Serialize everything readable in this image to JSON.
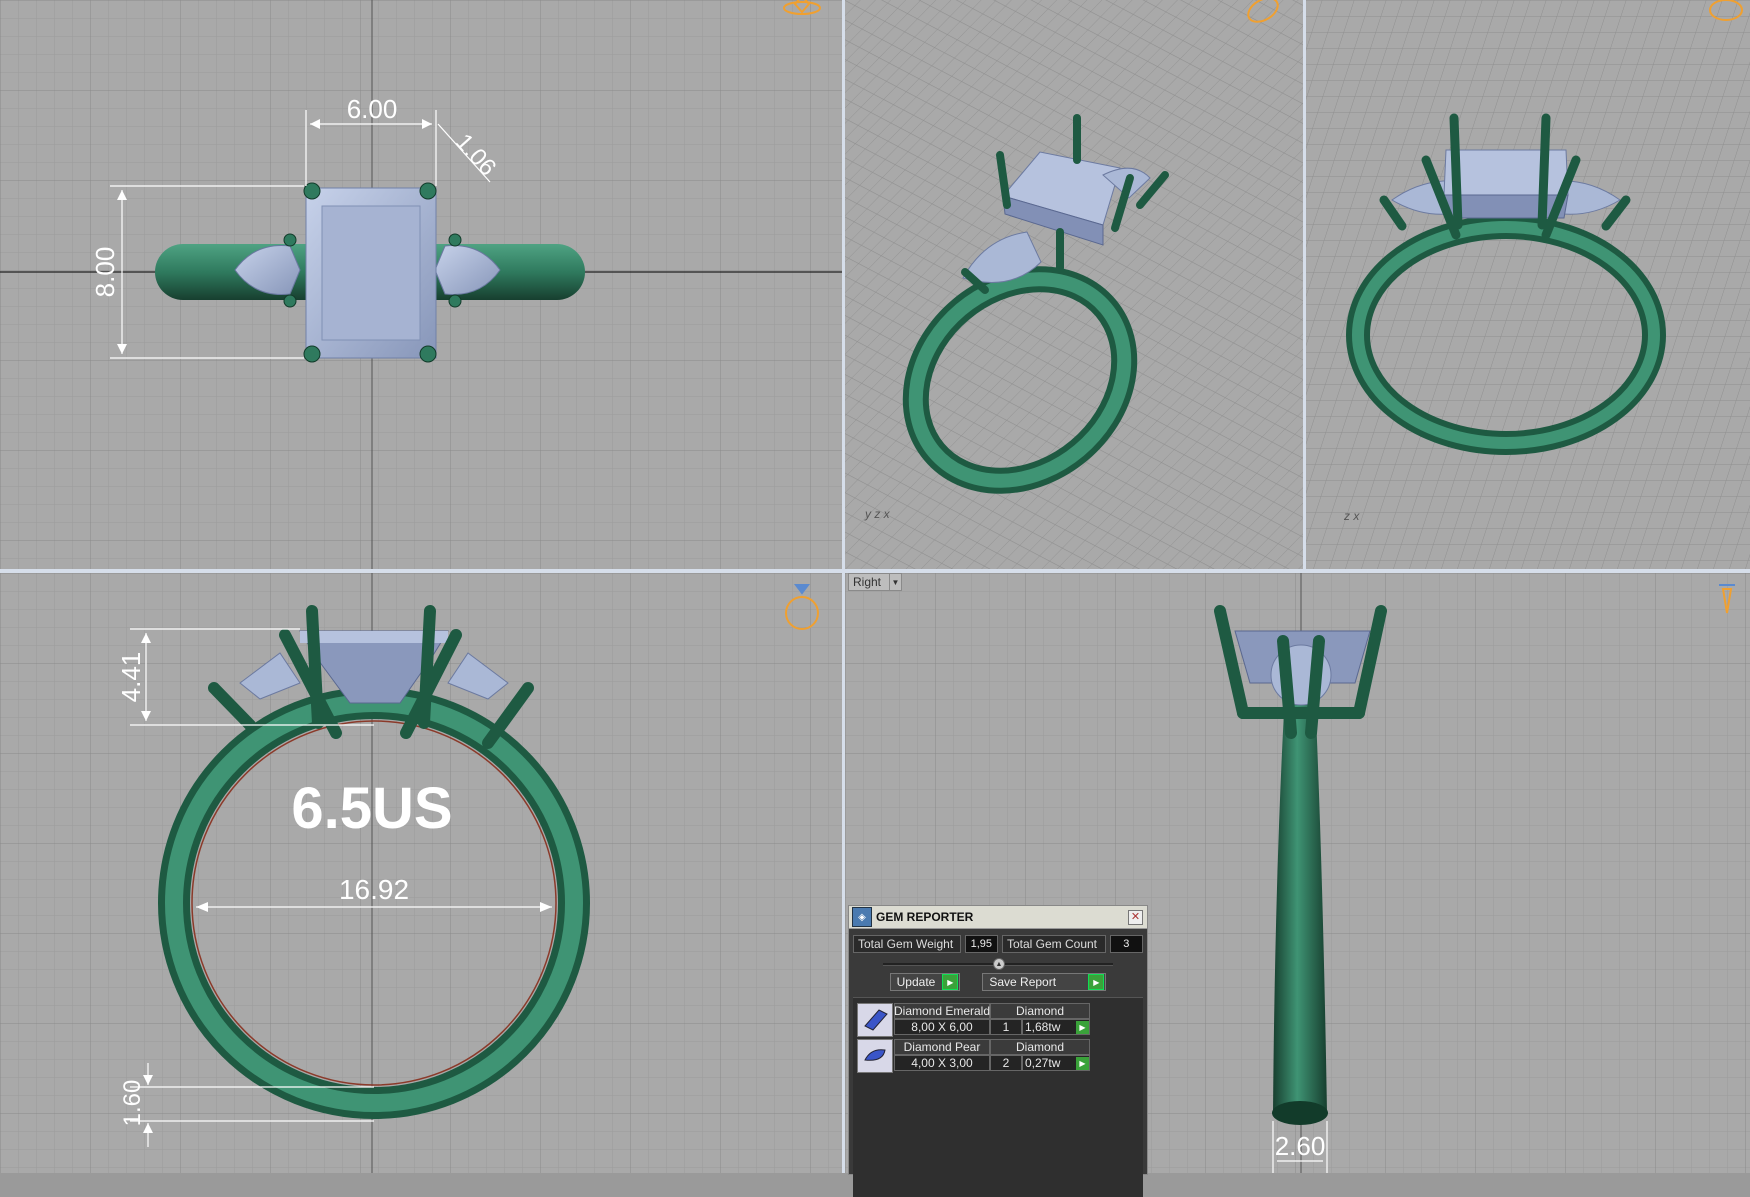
{
  "viewports": {
    "top": {
      "dim_width": "6.00",
      "dim_height": "8.00",
      "dim_prong": "1.06"
    },
    "front": {
      "dim_setting_height": "4.41",
      "ring_size": "6.5US",
      "dim_inner_diameter": "16.92",
      "dim_band_thickness": "1.60"
    },
    "right": {
      "view_label": "Right",
      "dim_band_width": "2.60"
    }
  },
  "gem_reporter": {
    "title": "GEM REPORTER",
    "total_weight_label": "Total Gem Weight",
    "total_weight_value": "1,95",
    "total_count_label": "Total Gem Count",
    "total_count_value": "3",
    "update_label": "Update",
    "save_report_label": "Save Report",
    "gems": [
      {
        "name": "Diamond Emerald",
        "material": "Diamond",
        "size": "8,00 X 6,00",
        "count": "1",
        "weight": "1,68tw"
      },
      {
        "name": "Diamond Pear",
        "material": "Diamond",
        "size": "4,00 X 3,00",
        "count": "2",
        "weight": "0,27tw"
      }
    ]
  },
  "colors": {
    "metal": "#2f7a5e",
    "metal_dark": "#1e5a42",
    "gem": "#aab8d6",
    "grid_bg": "#a9a9a9",
    "gizmo": "#f0a030"
  },
  "icons": {
    "close": "close-icon",
    "play": "play-icon",
    "gem_report": "gem-report-icon"
  }
}
